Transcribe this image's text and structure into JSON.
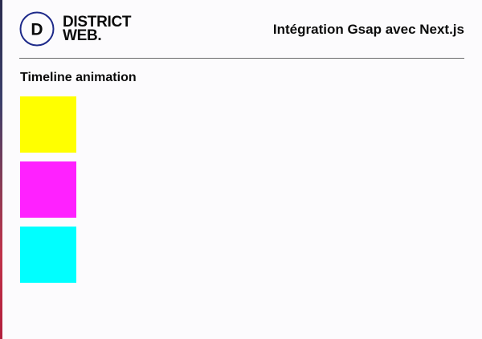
{
  "brand": {
    "logo_letter": "D",
    "name_line1": "DISTRICT",
    "name_line2": "WEB.",
    "accent_color": "#1e2a8a"
  },
  "header": {
    "title": "Intégration Gsap avec Next.js"
  },
  "section": {
    "heading": "Timeline animation"
  },
  "boxes": [
    {
      "name": "yellow-box",
      "color": "#ffff00"
    },
    {
      "name": "magenta-box",
      "color": "#ff21ff"
    },
    {
      "name": "cyan-box",
      "color": "#00ffff"
    }
  ]
}
